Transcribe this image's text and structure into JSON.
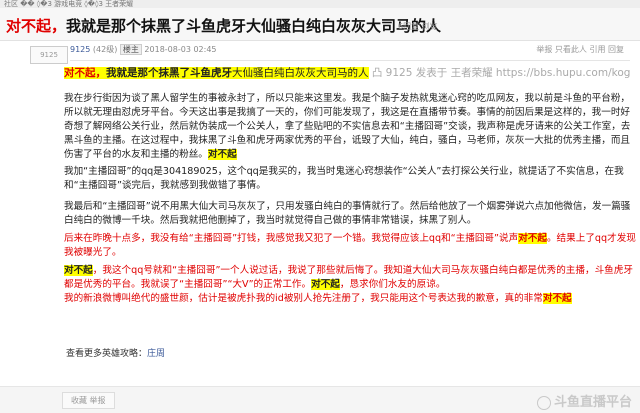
{
  "topbar": {
    "text": "社区 �� ◊�3 游戏电竞 ◊�◊3 王者荣耀"
  },
  "thread": {
    "title_red": "对不起，",
    "title_rest": "我就是那个抹黑了斗鱼虎牙大仙骚白纯白灰灰大司马的人",
    "views": "6回复 浏览"
  },
  "post": {
    "avatar_alt": "9125",
    "username": "9125",
    "level": "(42级)",
    "role_badge": "楼主",
    "datetime": "2018-08-03 02:45",
    "actions": "举报 只看此人 引用 回复"
  },
  "quote": {
    "red": "对不起，",
    "bold": "我就是那个抹黑了斗鱼虎牙",
    "rest": "大仙骚白纯白灰灰大司马的人",
    "link": "凸 9125 发表于 王者荣耀 https://bbs.hupu.com/kog"
  },
  "body": {
    "p1": "我在步行街因为谈了黑人留学生的事被永封了，所以只能来这里发。我是个脑子发热就鬼迷心窍的吃瓜网友，我以前是斗鱼的平台粉，所以就无理由怼虎牙平台。今天这出事是我搞了一天的，你们可能发现了，我这是在直播带节奏。事情的前因后果是这样的，我一时好奇想了解网络公关行业，然后就伪装成一个公关人，拿了些贴吧的不实信息去和“主播囧哥”交谈，我声称是虎牙请来的公关工作室，去黑斗鱼的主播。在这过程中，我抹黑了斗鱼和虎牙两家优秀的平台，诋毁了大仙，纯白，骚白，马老师，灰灰一大批的优秀主播，而且伤害了平台的水友和主播的粉丝。",
    "p1_tail": "对不起",
    "p2": "我加“主播囧哥”的qq是304189025，这个qq是我买的，我当时鬼迷心窍想装作“公关人”去打探公关行业，就提话了不实信息，在我和“主播囧哥”谈完后，我就感到我做错了事情。",
    "p3": "我最后和“主播囧哥”说不用黑大仙大司马灰灰了，只用发骚白纯白的事情就行了。然后给他放了一个烟雾弹说六点加他微信，发一篇骚白纯白的微博一千块。然后我就把他删掉了，我当时就觉得自己做的事情非常错误，抹黑了别人。",
    "p4": "后来在昨晚十点多，我没有给“主播囧哥”打钱，我感觉我又犯了一个错。我觉得应该上qq和“主播囧哥”说声",
    "p4_bold": "对不起",
    "p4_tail": "。结果上了qq才发现我被曝光了。",
    "p5_lead": "对不起",
    "p5": "，我这个qq号就和“主播囧哥”一个人说过话，我说了那些就后悔了。我知道大仙大司马灰灰骚白纯白都是优秀的主播，斗鱼虎牙都是优秀的平台。我就误了“主播囧哥”“大V”的正常工作。",
    "p5_bold": "对不起",
    "p5_end": "，恳求你们水友的原谅。",
    "p6": "我的新浪微博叫绝代的盛世颜，估计是被虎扑我的id被别人抢先注册了，我只能用这个号表达我的歉意，真的非常",
    "p6_bold": "对不起"
  },
  "footer": {
    "label": "查看更多英雄攻略：",
    "link": "庄周"
  },
  "bottom": {
    "report": "收藏 举报",
    "watermark": "斗鱼直播平台"
  }
}
